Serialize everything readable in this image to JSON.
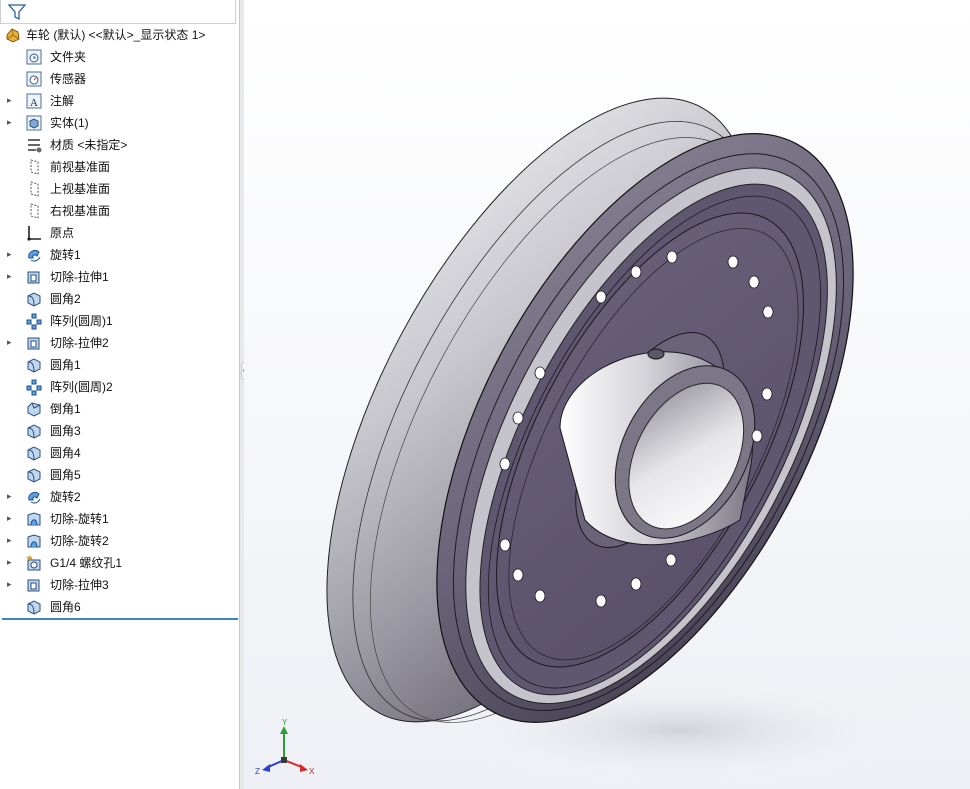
{
  "feature_tree": {
    "root": {
      "label": "车轮 (默认) <<默认>_显示状态 1>",
      "icon": "part-icon"
    },
    "items": [
      {
        "label": "文件夹",
        "icon": "history-folder-icon",
        "expandable": false
      },
      {
        "label": "传感器",
        "icon": "sensor-icon",
        "expandable": false
      },
      {
        "label": "注解",
        "icon": "annotation-icon",
        "expandable": true
      },
      {
        "label": "实体(1)",
        "icon": "solid-bodies-icon",
        "expandable": true
      },
      {
        "label": "材质 <未指定>",
        "icon": "material-icon",
        "expandable": false
      },
      {
        "label": "前视基准面",
        "icon": "plane-icon",
        "expandable": false
      },
      {
        "label": "上视基准面",
        "icon": "plane-icon",
        "expandable": false
      },
      {
        "label": "右视基准面",
        "icon": "plane-icon",
        "expandable": false
      },
      {
        "label": "原点",
        "icon": "origin-icon",
        "expandable": false
      },
      {
        "label": "旋转1",
        "icon": "revolve-icon",
        "expandable": true
      },
      {
        "label": "切除-拉伸1",
        "icon": "cut-extrude-icon",
        "expandable": true
      },
      {
        "label": "圆角2",
        "icon": "fillet-icon",
        "expandable": false
      },
      {
        "label": "阵列(圆周)1",
        "icon": "circular-pattern-icon",
        "expandable": false
      },
      {
        "label": "切除-拉伸2",
        "icon": "cut-extrude-icon",
        "expandable": true
      },
      {
        "label": "圆角1",
        "icon": "fillet-icon",
        "expandable": false
      },
      {
        "label": "阵列(圆周)2",
        "icon": "circular-pattern-icon",
        "expandable": false
      },
      {
        "label": "倒角1",
        "icon": "chamfer-icon",
        "expandable": false
      },
      {
        "label": "圆角3",
        "icon": "fillet-icon",
        "expandable": false
      },
      {
        "label": "圆角4",
        "icon": "fillet-icon",
        "expandable": false
      },
      {
        "label": "圆角5",
        "icon": "fillet-icon",
        "expandable": false
      },
      {
        "label": "旋转2",
        "icon": "revolve-icon",
        "expandable": true
      },
      {
        "label": "切除-旋转1",
        "icon": "cut-revolve-icon",
        "expandable": true
      },
      {
        "label": "切除-旋转2",
        "icon": "cut-revolve-icon",
        "expandable": true
      },
      {
        "label": "G1/4 螺纹孔1",
        "icon": "hole-wizard-icon",
        "expandable": true
      },
      {
        "label": "切除-拉伸3",
        "icon": "cut-extrude-icon",
        "expandable": true
      },
      {
        "label": "圆角6",
        "icon": "fillet-icon",
        "expandable": false
      }
    ]
  },
  "triad": {
    "x": "X",
    "y": "Y",
    "z": "Z"
  },
  "colors": {
    "face_purple": "#5d5470",
    "rim_silver": "#c9c9cf",
    "rollback_blue": "#3a86c8"
  }
}
